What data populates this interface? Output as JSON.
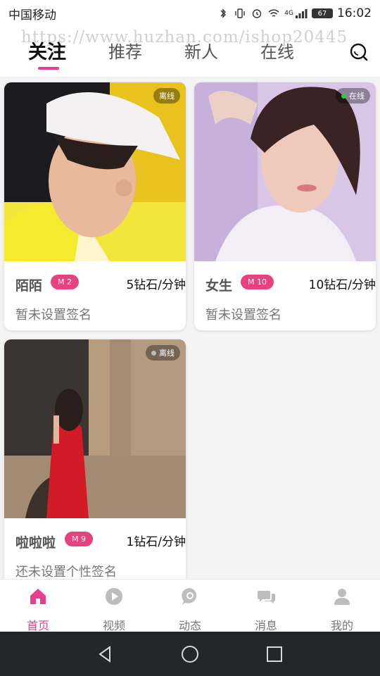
{
  "status_bar": {
    "carrier": "中国移动",
    "battery": "67",
    "network": "4G",
    "time": "16:02"
  },
  "watermark": "https://www.huzhan.com/ishop20445",
  "tabs": [
    {
      "label": "关注",
      "active": true
    },
    {
      "label": "推荐",
      "active": false
    },
    {
      "label": "新人",
      "active": false
    },
    {
      "label": "在线",
      "active": false
    }
  ],
  "search_icon": "search-icon",
  "cards": [
    {
      "name": "陌陌",
      "level": "M 2",
      "price": "5钻石/分钟",
      "signature": "暂未设置签名",
      "status": "离线",
      "online": false
    },
    {
      "name": "女生",
      "level": "M 10",
      "price": "10钻石/分钟",
      "signature": "暂未设置签名",
      "status": "在线",
      "online": true
    },
    {
      "name": "啦啦啦",
      "level": "M 9",
      "price": "1钻石/分钟",
      "signature": "还未设置个性签名",
      "status": "离线",
      "online": false
    }
  ],
  "bottom_nav": [
    {
      "label": "首页",
      "icon": "home-icon",
      "active": true
    },
    {
      "label": "视频",
      "icon": "play-icon",
      "active": false
    },
    {
      "label": "动态",
      "icon": "chat-bubble-icon",
      "active": false
    },
    {
      "label": "消息",
      "icon": "messages-icon",
      "active": false
    },
    {
      "label": "我的",
      "icon": "user-icon",
      "active": false
    }
  ],
  "colors": {
    "accent": "#e83e8c",
    "online_dot": "#2ecc40",
    "offline_dot": "#bbbbbb",
    "nav_inactive": "#bdbdbd",
    "system_nav_bg": "#23262b"
  }
}
